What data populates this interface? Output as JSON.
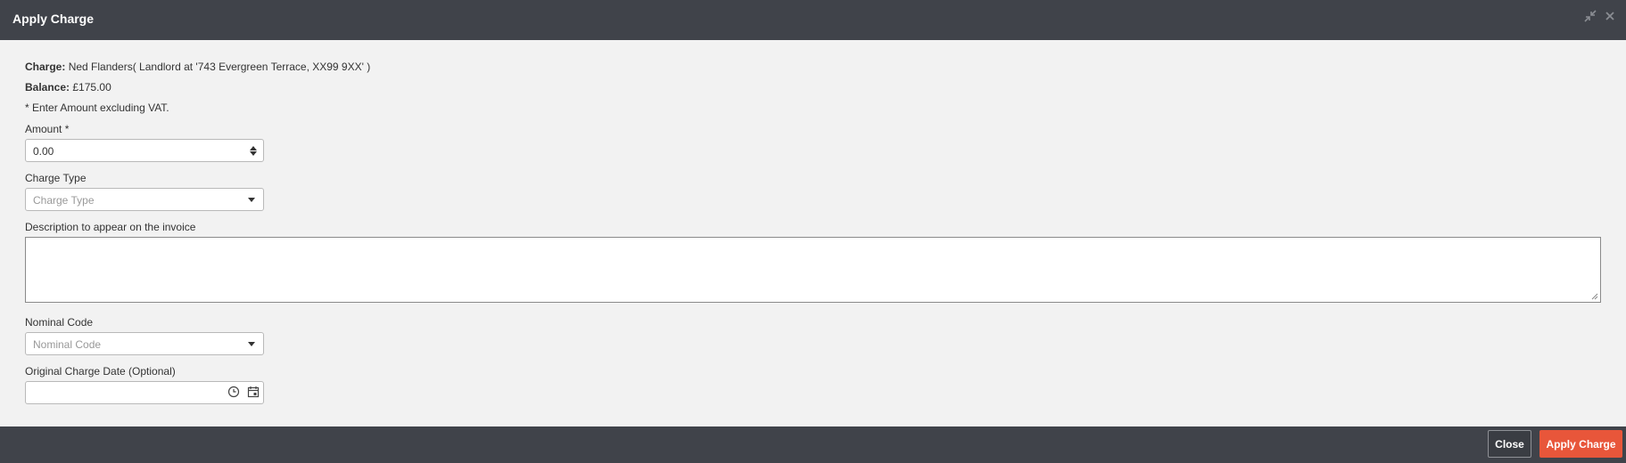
{
  "dialog": {
    "title": "Apply Charge",
    "header_icons": [
      "collapse-icon",
      "close-icon"
    ]
  },
  "info": {
    "charge_label": "Charge:",
    "charge_value": "Ned Flanders( Landlord at '743 Evergreen Terrace, XX99 9XX' )",
    "balance_label": "Balance:",
    "balance_value": "£175.00",
    "vat_note": "* Enter Amount excluding VAT."
  },
  "form": {
    "amount": {
      "label": "Amount *",
      "value": "0.00"
    },
    "charge_type": {
      "label": "Charge Type",
      "placeholder": "Charge Type"
    },
    "description": {
      "label": "Description to appear on the invoice",
      "value": ""
    },
    "nominal_code": {
      "label": "Nominal Code",
      "placeholder": "Nominal Code"
    },
    "original_charge_date": {
      "label": "Original Charge Date (Optional)",
      "value": ""
    }
  },
  "footer": {
    "close_label": "Close",
    "apply_label": "Apply Charge"
  },
  "colors": {
    "header_bg": "#40434a",
    "body_bg": "#f2f2f2",
    "apply_button": "#e8563a"
  }
}
